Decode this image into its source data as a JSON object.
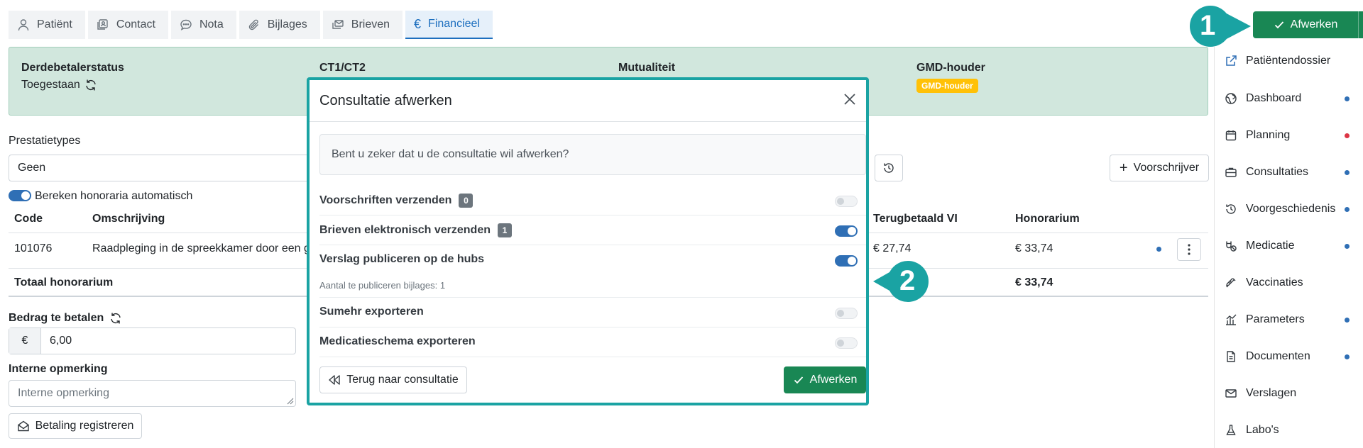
{
  "tabs": [
    {
      "label": "Patiënt",
      "icon": "person-icon"
    },
    {
      "label": "Contact",
      "icon": "contact-card-icon"
    },
    {
      "label": "Nota",
      "icon": "chat-bubble-icon"
    },
    {
      "label": "Bijlages",
      "icon": "paperclip-icon"
    },
    {
      "label": "Brieven",
      "icon": "letters-icon"
    },
    {
      "label": "Financieel",
      "icon": "euro-icon",
      "active": true
    }
  ],
  "toolbar": {
    "afwerken_label": "Afwerken"
  },
  "markers": {
    "one": "1",
    "two": "2"
  },
  "status": {
    "derdebetaler_label": "Derdebetalerstatus",
    "derdebetaler_value": "Toegestaan",
    "ct_label": "CT1/CT2",
    "mutualiteit_label": "Mutualiteit",
    "gmd_label": "GMD-houder",
    "gmd_badge": "GMD-houder"
  },
  "sidebar": {
    "items": [
      {
        "label": "Patiëntendossier",
        "icon": "external-link-icon",
        "dot": null
      },
      {
        "label": "Dashboard",
        "icon": "globe-icon",
        "dot": "#2f6fb5"
      },
      {
        "label": "Planning",
        "icon": "calendar-icon",
        "dot": "#dc3545"
      },
      {
        "label": "Consultaties",
        "icon": "briefcase-icon",
        "dot": "#2f6fb5"
      },
      {
        "label": "Voorgeschiedenis",
        "icon": "history-icon",
        "dot": "#2f6fb5"
      },
      {
        "label": "Medicatie",
        "icon": "pill-icon",
        "dot": "#2f6fb5"
      },
      {
        "label": "Vaccinaties",
        "icon": "syringe-icon",
        "dot": null
      },
      {
        "label": "Parameters",
        "icon": "chart-icon",
        "dot": "#2f6fb5"
      },
      {
        "label": "Documenten",
        "icon": "document-icon",
        "dot": "#2f6fb5"
      },
      {
        "label": "Verslagen",
        "icon": "envelope-icon",
        "dot": null
      },
      {
        "label": "Labo's",
        "icon": "flask-icon",
        "dot": null
      }
    ]
  },
  "main": {
    "prestatietypes_label": "Prestatietypes",
    "prestatietypes_value": "Geen",
    "voorschrijver_label": "Voorschrijver",
    "bereken_label": "Bereken honoraria automatisch",
    "table": {
      "headers": {
        "code": "Code",
        "omschrijving": "Omschrijving",
        "terugbetaald": "Terugbetaald VI",
        "honorarium": "Honorarium"
      },
      "row": {
        "code": "101076",
        "omschrijving": "Raadpleging in de spreekkamer door een g",
        "terugbetaald": "€ 27,74",
        "honorarium": "€ 33,74"
      },
      "total_label": "Totaal honorarium",
      "total_value": "€ 33,74"
    },
    "bedrag_label": "Bedrag te betalen",
    "currency_symbol": "€",
    "bedrag_value": "6,00",
    "opmerking_label": "Interne opmerking",
    "opmerking_placeholder": "Interne opmerking",
    "betaling_label": "Betaling registreren"
  },
  "modal": {
    "title": "Consultatie afwerken",
    "message": "Bent u zeker dat u de consultatie wil afwerken?",
    "options": [
      {
        "label": "Voorschriften verzenden",
        "count": "0",
        "on": false
      },
      {
        "label": "Brieven elektronisch verzenden",
        "count": "1",
        "on": true
      },
      {
        "label": "Verslag publiceren op de hubs",
        "count": null,
        "on": true,
        "sub": "Aantal te publiceren bijlages: 1"
      },
      {
        "label": "Sumehr exporteren",
        "count": null,
        "on": false
      },
      {
        "label": "Medicatieschema exporteren",
        "count": null,
        "on": false
      }
    ],
    "back_label": "Terug naar consultatie",
    "confirm_label": "Afwerken"
  },
  "colors": {
    "accent": "#1aa3a3",
    "success": "#198754",
    "primary": "#2f6fb5",
    "status_bg": "#d1e7dd",
    "warning": "#ffc107"
  }
}
